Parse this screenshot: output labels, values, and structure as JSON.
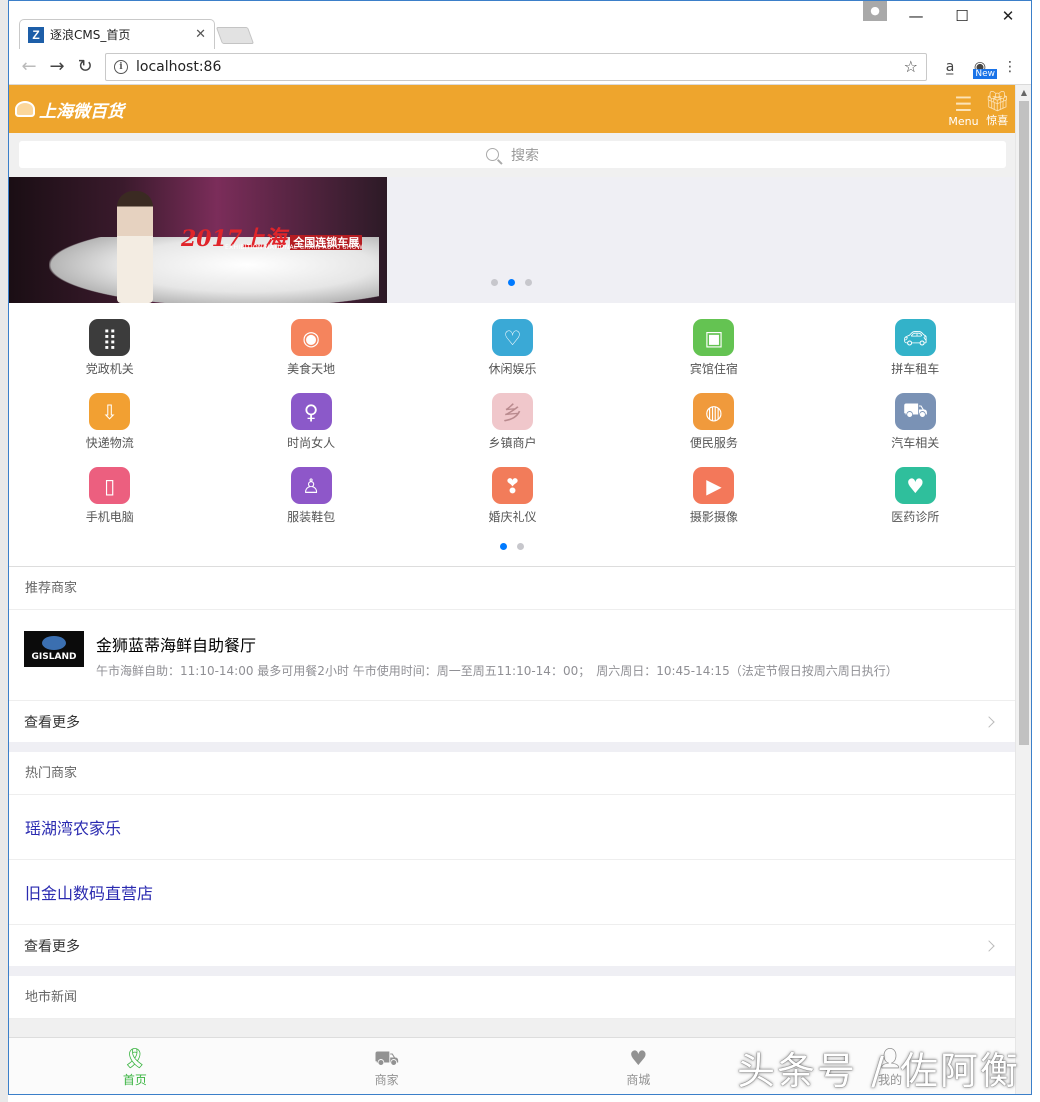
{
  "browser": {
    "tab_title": "逐浪CMS_首页",
    "tab_favicon": "Z",
    "url": "localhost:86",
    "ext_new_badge": "New"
  },
  "site": {
    "logo_text": "上海微百货",
    "header_menu_label": "Menu",
    "header_gift_label": "惊喜",
    "search_placeholder": "搜索",
    "banner": {
      "headline_year": "2017",
      "headline_city": "上海",
      "headline_badge": "全国连锁车展",
      "sub": "EXHIBITION NATIONAL CHAIN AUTO SHOW",
      "slides": 3,
      "active_slide": 2
    },
    "categories": [
      {
        "label": "党政机关",
        "icon": "dots-grid-icon",
        "color": "#3c3c3c"
      },
      {
        "label": "美食天地",
        "icon": "plate-icon",
        "color": "#f5845d"
      },
      {
        "label": "休闲娱乐",
        "icon": "balloon-hearts-icon",
        "color": "#3aa9d6"
      },
      {
        "label": "宾馆住宿",
        "icon": "hotel-icon",
        "color": "#64c352"
      },
      {
        "label": "拼车租车",
        "icon": "car-icon",
        "color": "#33b2c9"
      },
      {
        "label": "快递物流",
        "icon": "cart-icon",
        "color": "#f2a032"
      },
      {
        "label": "时尚女人",
        "icon": "woman-icon",
        "color": "#8b59c9"
      },
      {
        "label": "乡镇商户",
        "icon": "village-icon",
        "color": "#f0c7cb"
      },
      {
        "label": "便民服务",
        "icon": "globe-hands-icon",
        "color": "#f09a3c"
      },
      {
        "label": "汽车相关",
        "icon": "car-front-icon",
        "color": "#7a92b5"
      },
      {
        "label": "手机电脑",
        "icon": "phone-icon",
        "color": "#ec5f7f"
      },
      {
        "label": "服装鞋包",
        "icon": "dress-icon",
        "color": "#8e57c9"
      },
      {
        "label": "婚庆礼仪",
        "icon": "love-bubble-icon",
        "color": "#f27c5a"
      },
      {
        "label": "摄影摄像",
        "icon": "clapper-icon",
        "color": "#f3785a"
      },
      {
        "label": "医药诊所",
        "icon": "heart-icon",
        "color": "#2fbf9c"
      }
    ],
    "category_pages": 2,
    "category_active_page": 1,
    "recommended": {
      "title": "推荐商家",
      "merchant_name": "金狮蓝蒂海鲜自助餐厅",
      "merchant_logo_text": "GISLAND",
      "merchant_desc": "午市海鲜自助：11:10-14:00 最多可用餐2小时 午市使用时间：周一至周五11:10-14：00；　周六周日：10:45-14:15（法定节假日按周六周日执行）",
      "more": "查看更多"
    },
    "hot": {
      "title": "热门商家",
      "items": [
        "瑶湖湾农家乐",
        "旧金山数码直营店"
      ],
      "more": "查看更多"
    },
    "news": {
      "title": "地市新闻"
    },
    "tabbar": [
      {
        "label": "首页",
        "icon": "ribbon-icon",
        "active": true
      },
      {
        "label": "商家",
        "icon": "truck-icon",
        "active": false
      },
      {
        "label": "商城",
        "icon": "heart-icon",
        "active": false
      },
      {
        "label": "我的",
        "icon": "user-icon",
        "active": false
      }
    ],
    "watermark": "头条号 / 佐阿衡"
  },
  "colors": {
    "header": "#eea52d",
    "tab_active": "#3ab441",
    "dot_active": "#007aff"
  }
}
